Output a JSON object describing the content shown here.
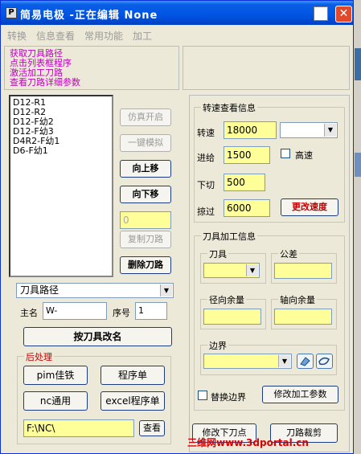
{
  "window": {
    "title": "简易电极 -正在编辑 None",
    "icon_label": "P"
  },
  "menu": [
    "转换",
    "信息查看",
    "常用功能",
    "加工"
  ],
  "info_lines": [
    "获取刀具路径",
    "点击列表框程序",
    "激活加工刀路",
    "查看刀路详细参数"
  ],
  "toolpath_list": [
    "D12-R1",
    "D12-R2",
    "D12-F幼2",
    "D12-F幼3",
    "D4R2-F幼1",
    "D6-F幼1"
  ],
  "mid_buttons": {
    "sim_on": "仿真开启",
    "one_key_sim": "一键模拟",
    "move_up": "向上移",
    "move_down": "向下移",
    "copy_path": "复制刀路",
    "delete_path": "删除刀路"
  },
  "copy_count_value": "0",
  "combo_toolpath": "刀具路径",
  "main_name_label": "主名",
  "main_name_value": "W-",
  "seq_label": "序号",
  "seq_value": "1",
  "rename_button": "按刀具改名",
  "post": {
    "title": "后处理",
    "pim_button": "pim佳铁",
    "program_sheet_button": "程序单",
    "nc_button": "nc通用",
    "excel_button": "excel程序单",
    "path_value": "F:\\NC\\",
    "view_button": "查看"
  },
  "speed": {
    "title": "转速查看信息",
    "spindle_label": "转速",
    "spindle_value": "18000",
    "feed_label": "进给",
    "feed_value": "1500",
    "high_speed_label": "高速",
    "plunge_label": "下切",
    "plunge_value": "500",
    "traverse_label": "掠过",
    "traverse_value": "6000",
    "change_speed_button": "更改速度"
  },
  "tool_info": {
    "title": "刀具加工信息",
    "tool_group": "刀具",
    "tolerance_group": "公差",
    "radial_group": "径向余量",
    "axial_group": "轴向余量",
    "boundary_group": "边界",
    "replace_boundary_label": "替换边界",
    "modify_params_button": "修改加工参数"
  },
  "bottom_buttons": {
    "modify_plunge": "修改下刀点",
    "trim_path": "刀路裁剪"
  },
  "watermark": "三维网www.3dportal.cn",
  "colors": {
    "accent_blue": "#0054e3",
    "info_text": "#c000c0",
    "input_yellow": "#ffff99",
    "post_title_red": "#c00000"
  }
}
